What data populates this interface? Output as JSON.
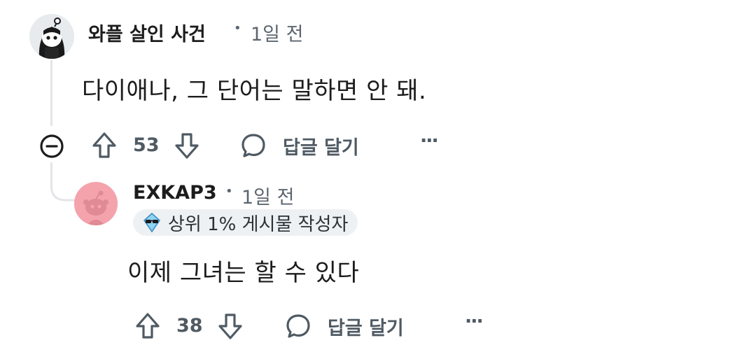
{
  "comments": [
    {
      "username": "와플 살인 사건",
      "time": "1일 전",
      "body": "다이애나, 그 단어는 말하면 안 돼.",
      "votes": "53",
      "reply_label": "답글 달기",
      "more_label": "···",
      "avatar_icon": "snoo-avatar-dark-hair"
    },
    {
      "username": "EXKAP3",
      "time": "1일 전",
      "badge": "상위 1% 게시물 작성자",
      "body": "이제 그녀는 할 수 있다",
      "votes": "38",
      "reply_label": "답글 달기",
      "more_label": "···",
      "avatar_icon": "snoo-avatar-pink"
    }
  ],
  "separator": "•",
  "colors": {
    "action_gray": "#4f5a63",
    "meta_gray": "#5c6670",
    "thread_line": "#e3e5e8",
    "avatar_pink": "#f4a3ad",
    "badge_bg": "#eef1f3"
  }
}
